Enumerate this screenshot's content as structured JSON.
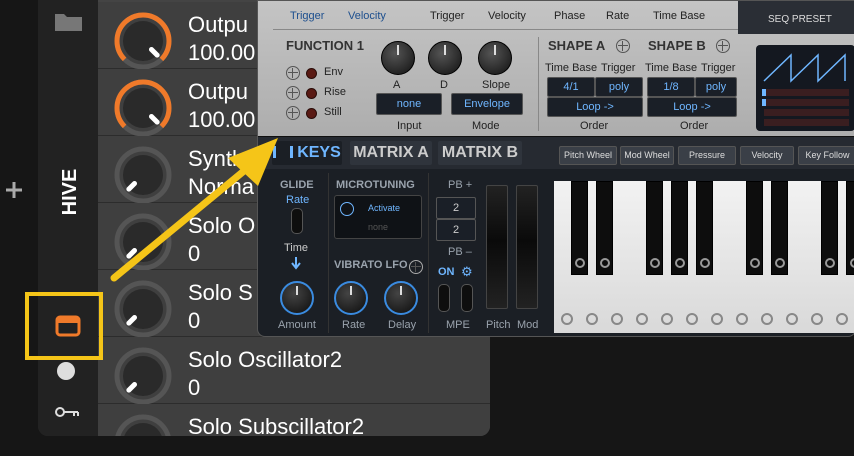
{
  "daw": {
    "device_name": "HIVE",
    "sidebar_icons": [
      "folder-icon",
      "plus-icon",
      "window-icon",
      "circle-icon",
      "key-icon"
    ],
    "params": [
      {
        "name": "Outpu",
        "value": "100.00",
        "level": 1.0
      },
      {
        "name": "Outpu",
        "value": "100.00",
        "level": 1.0
      },
      {
        "name": "Synth",
        "value": "Norma",
        "level": 0.0
      },
      {
        "name": "Solo O",
        "value": "0",
        "level": 0.0
      },
      {
        "name": "Solo S",
        "value": "0",
        "level": 0.0
      },
      {
        "name": "Solo Oscillator2",
        "value": "0",
        "level": 0.0
      },
      {
        "name": "Solo Subscillator2",
        "value": "",
        "level": 0.0
      }
    ],
    "accent_color": "#f07a2a",
    "highlight_color": "#f5c518"
  },
  "synth": {
    "top_labels": {
      "trigger1": "Trigger",
      "velocity1": "Velocity",
      "trigger2": "Trigger",
      "velocity2": "Velocity",
      "phase": "Phase",
      "rate": "Rate",
      "timebase": "Time Base",
      "seq_preset": "SEQ PRESET"
    },
    "function1": {
      "title": "FUNCTION 1",
      "modes": [
        "Env",
        "Rise",
        "Still"
      ],
      "knob_labels": [
        "A",
        "D",
        "Slope"
      ],
      "input_value": "none",
      "input_label": "Input",
      "mode_value": "Envelope",
      "mode_label": "Mode"
    },
    "shape_a": {
      "title": "SHAPE A",
      "timebase_label": "Time Base",
      "trigger_label": "Trigger",
      "timebase": "4/1",
      "trigger": "poly",
      "loop": "Loop ->",
      "order_label": "Order"
    },
    "shape_b": {
      "title": "SHAPE B",
      "timebase_label": "Time Base",
      "trigger_label": "Trigger",
      "timebase": "1/8",
      "trigger": "poly",
      "loop": "Loop ->",
      "order_label": "Order"
    },
    "tabs": [
      "KEYS",
      "MATRIX A",
      "MATRIX B"
    ],
    "mod_tags": [
      "Pitch Wheel",
      "Mod Wheel",
      "Pressure",
      "Velocity",
      "Key Follow"
    ],
    "glide": {
      "title": "GLIDE",
      "rate_label": "Rate",
      "time_label": "Time",
      "amount_label": "Amount"
    },
    "microtuning": {
      "title": "MICROTUNING",
      "activate": "Activate",
      "value": "none"
    },
    "vibrato": {
      "title": "VIBRATO LFO",
      "rate_label": "Rate",
      "delay_label": "Delay"
    },
    "pb": {
      "plus_label": "PB +",
      "plus_value": "2",
      "minus_label": "PB –",
      "minus_value": "2",
      "on_label": "ON",
      "mpe_label": "MPE"
    },
    "wheels": {
      "pitch_label": "Pitch",
      "mod_label": "Mod"
    }
  }
}
